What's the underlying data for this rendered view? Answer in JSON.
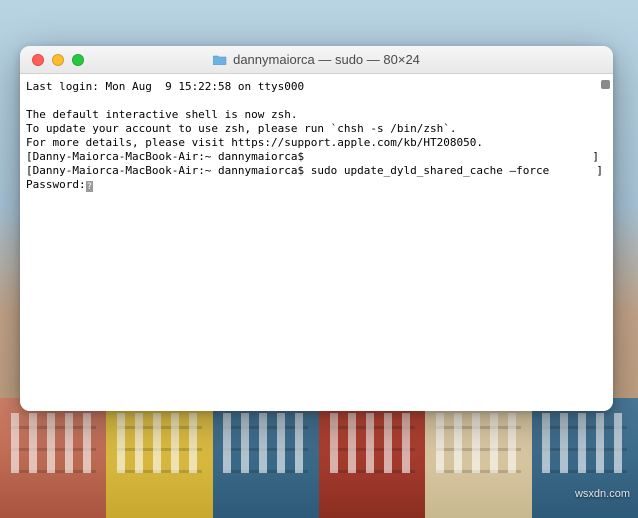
{
  "window": {
    "title": "dannymaiorca — sudo — 80×24"
  },
  "terminal": {
    "last_login": "Last login: Mon Aug  9 15:22:58 on ttys000",
    "shell_msg1": "The default interactive shell is now zsh.",
    "shell_msg2": "To update your account to use zsh, please run `chsh -s /bin/zsh`.",
    "shell_msg3": "For more details, please visit https://support.apple.com/kb/HT208050.",
    "prompt1_host": "Danny-Maiorca-MacBook-Air:~ dannymaiorca$",
    "prompt1_cmd": " ",
    "prompt2_host": "Danny-Maiorca-MacBook-Air:~ dannymaiorca$",
    "prompt2_cmd": " sudo update_dyld_shared_cache —force",
    "password_label": "Password:"
  },
  "watermark": "wsxdn.com"
}
